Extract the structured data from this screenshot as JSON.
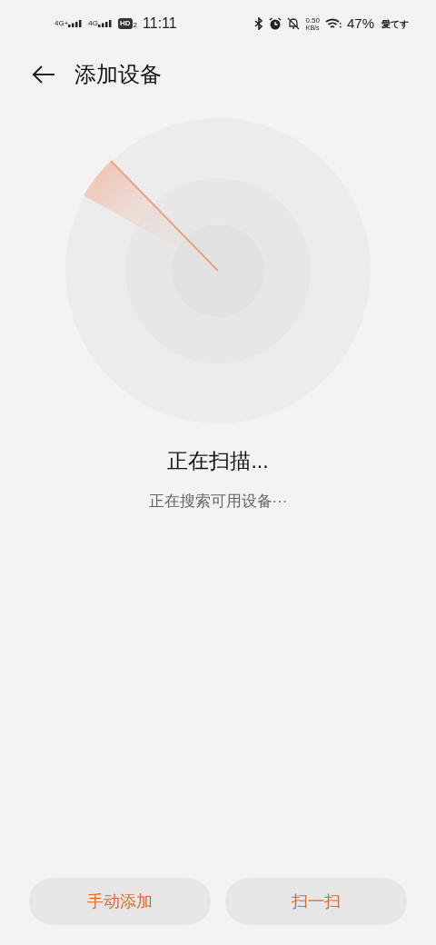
{
  "status_bar": {
    "network_1": "4G+",
    "network_2": "4G",
    "hd": "HD",
    "hd_sub": "2",
    "time": "11:11",
    "speed_value": "0.50",
    "speed_unit": "KB/s",
    "battery": "47%",
    "carrier_note": "愛てす"
  },
  "header": {
    "title": "添加设备"
  },
  "scan": {
    "title": "正在扫描...",
    "subtitle": "正在搜索可用设备···"
  },
  "buttons": [
    {
      "label": "手动添加"
    },
    {
      "label": "扫一扫"
    }
  ]
}
